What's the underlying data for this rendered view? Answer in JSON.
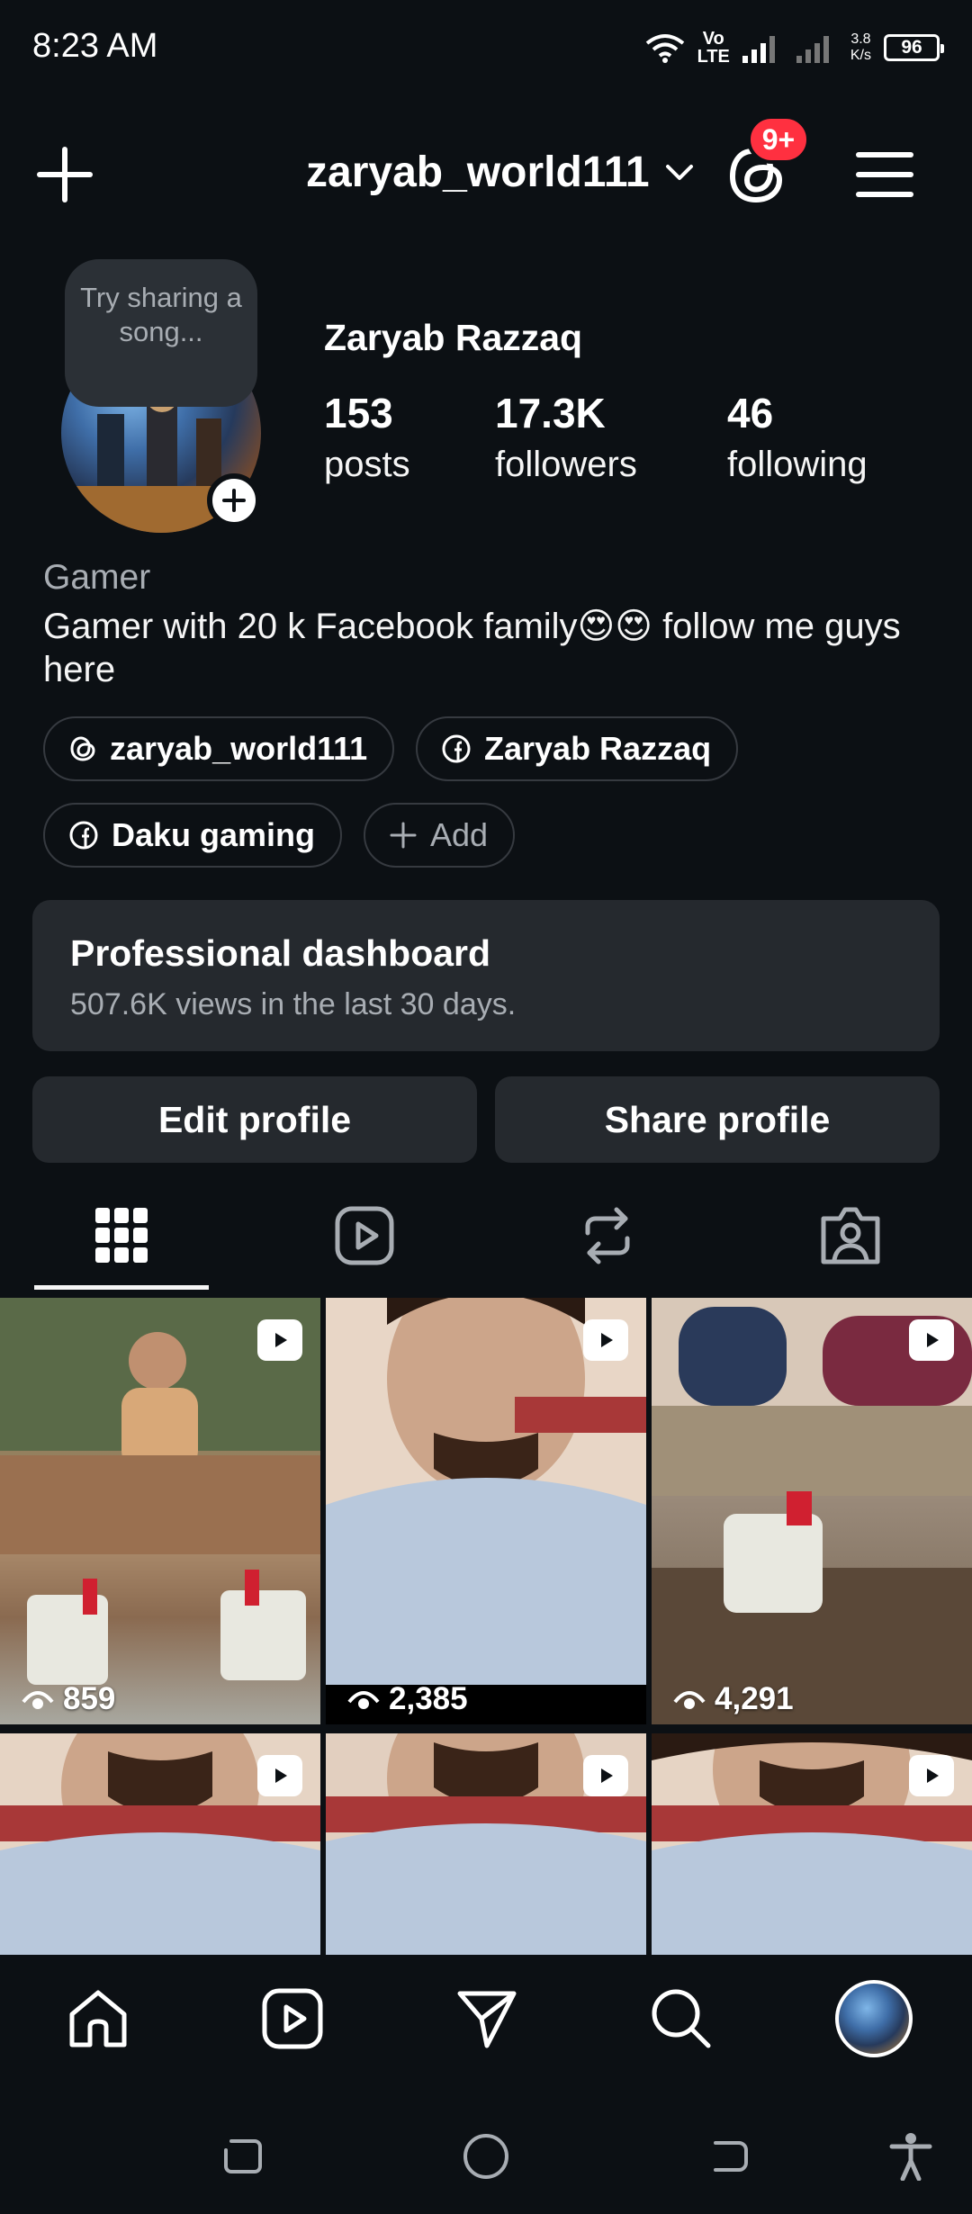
{
  "status_bar": {
    "time": "8:23 AM",
    "network_top": "Vo",
    "network_bottom": "LTE",
    "speed_value": "3.8",
    "speed_unit": "K/s",
    "battery": "96"
  },
  "header": {
    "username": "zaryab_world111",
    "notification_badge": "9+"
  },
  "profile": {
    "note": "Try sharing a song...",
    "display_name": "Zaryab Razzaq",
    "stats": [
      {
        "value": "153",
        "label": "posts"
      },
      {
        "value": "17.3K",
        "label": "followers"
      },
      {
        "value": "46",
        "label": "following"
      }
    ],
    "category": "Gamer",
    "bio": "Gamer with  20 k Facebook family😍😍 follow me guys here",
    "links": {
      "threads": "zaryab_world111",
      "facebook_profile": "Zaryab Razzaq",
      "facebook_page": "Daku gaming",
      "add": "Add"
    }
  },
  "dashboard": {
    "title": "Professional dashboard",
    "subtitle": "507.6K views in the last 30 days."
  },
  "buttons": {
    "edit": "Edit profile",
    "share": "Share profile"
  },
  "tabs": [
    "grid-icon",
    "reels-icon",
    "reposts-icon",
    "tagged-icon"
  ],
  "posts": [
    {
      "views": "859",
      "type": "reel"
    },
    {
      "views": "2,385",
      "type": "reel"
    },
    {
      "views": "4,291",
      "type": "reel"
    },
    {
      "views": "",
      "type": "reel"
    },
    {
      "views": "",
      "type": "reel"
    },
    {
      "views": "",
      "type": "reel"
    }
  ],
  "colors": {
    "background": "#0c1014",
    "surface": "#25292e",
    "badge": "#ff3040",
    "muted_text": "#a8adb3"
  }
}
